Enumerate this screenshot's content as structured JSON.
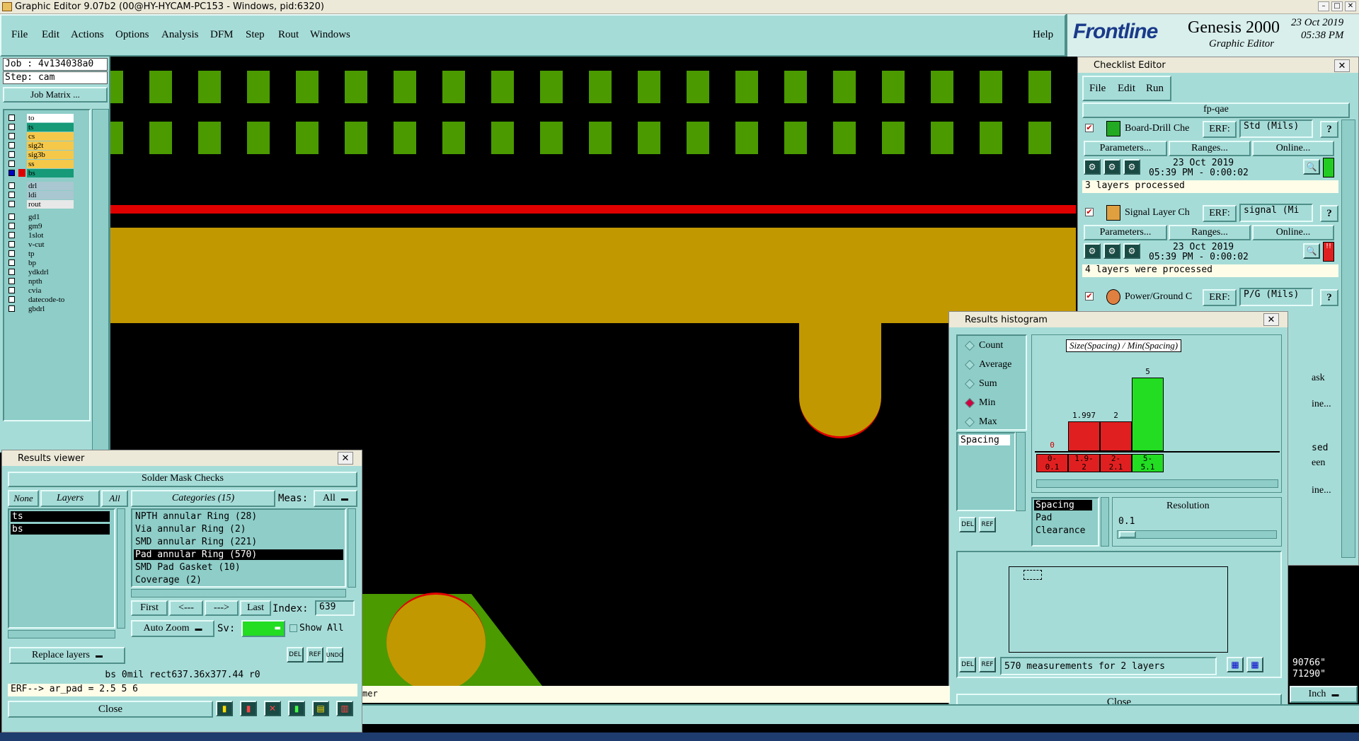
{
  "window_title": "Graphic Editor 9.07b2 (00@HY-HYCAM-PC153 - Windows, pid:6320)",
  "menu": [
    "File",
    "Edit",
    "Actions",
    "Options",
    "Analysis",
    "DFM",
    "Step",
    "Rout",
    "Windows"
  ],
  "help": "Help",
  "brand": {
    "logo": "Frontline",
    "product": "Genesis 2000",
    "subtitle": "Graphic Editor",
    "date": "23 Oct 2019",
    "time": "05:38 PM"
  },
  "job": {
    "job": "Job : 4v134038a0",
    "step": "Step: cam",
    "matrix_button": "Job Matrix ..."
  },
  "layers": [
    {
      "name": "to",
      "color": "#ffffff"
    },
    {
      "name": "ts",
      "color": "#169a78"
    },
    {
      "name": "cs",
      "color": "#f5c84a"
    },
    {
      "name": "sig2t",
      "color": "#f5c84a"
    },
    {
      "name": "sig3b",
      "color": "#f5c84a"
    },
    {
      "name": "ss",
      "color": "#f5c84a"
    },
    {
      "name": "bs",
      "color": "#169a78"
    },
    {
      "name": "drl",
      "color": "#a9c7d0"
    },
    {
      "name": "ldi",
      "color": "#a9c7d0"
    },
    {
      "name": "rout",
      "color": "#e8e8e8"
    },
    {
      "name": "gd1",
      "color": "#8ecdc8"
    },
    {
      "name": "gm9",
      "color": "#8ecdc8"
    },
    {
      "name": "1slot",
      "color": "#8ecdc8"
    },
    {
      "name": "v-cut",
      "color": "#8ecdc8"
    },
    {
      "name": "tp",
      "color": "#8ecdc8"
    },
    {
      "name": "bp",
      "color": "#8ecdc8"
    },
    {
      "name": "ydkdrl",
      "color": "#8ecdc8"
    },
    {
      "name": "npth",
      "color": "#8ecdc8"
    },
    {
      "name": "cvia",
      "color": "#8ecdc8"
    },
    {
      "name": "datecode-to",
      "color": "#8ecdc8"
    },
    {
      "name": "gbdrl",
      "color": "#8ecdc8"
    }
  ],
  "checklist": {
    "title": "Checklist Editor",
    "menu": [
      "File",
      "Edit",
      "Run"
    ],
    "name": "fp-qae",
    "erf_label": "ERF:",
    "params_label": "Parameters...",
    "ranges_label": "Ranges...",
    "online_label": "Online...",
    "checks": [
      {
        "name": "Board-Drill Che",
        "erf": "Std (Mils)",
        "date": "23 Oct 2019",
        "time": "05:39 PM - 0:00:02",
        "status": "3 layers processed",
        "flag": "#22cc22"
      },
      {
        "name": "Signal Layer Ch",
        "erf": "signal (Mi",
        "date": "23 Oct 2019",
        "time": "05:39 PM - 0:00:02",
        "status": "4 layers were processed",
        "flag": "#e02020"
      },
      {
        "name": "Power/Ground C",
        "erf": "P/G (Mils)"
      }
    ],
    "partial_texts": [
      "ask",
      "ine...",
      "sed",
      "een",
      "ine..."
    ]
  },
  "histogram": {
    "title": "Results histogram",
    "modes": [
      "Count",
      "Average",
      "Sum",
      "Min",
      "Max"
    ],
    "selected_mode": "Min",
    "measures": [
      "Spacing"
    ],
    "chart_title": "Size(Spacing) / Min(Spacing)",
    "bins": [
      {
        "label": "0-\n0.1",
        "value": 0,
        "text": "0",
        "color": "#e02020"
      },
      {
        "label": "1.9-\n2",
        "value": 1.997,
        "text": "1.997",
        "color": "#e02020"
      },
      {
        "label": "2-\n2.1",
        "value": 2,
        "text": "2",
        "color": "#e02020"
      },
      {
        "label": "5-\n5.1",
        "value": 5,
        "text": "5",
        "color": "#22dd22"
      }
    ],
    "ymax": 5,
    "attributes": [
      "Spacing",
      "Pad",
      "Clearance"
    ],
    "resolution_label": "Resolution",
    "resolution": "0.1",
    "summary": "570 measurements for 2 layers",
    "close": "Close"
  },
  "results": {
    "title": "Results viewer",
    "header": "Solder Mask Checks",
    "none": "None",
    "layers": "Layers",
    "all": "All",
    "layer_list": [
      "ts",
      "bs"
    ],
    "categories_label": "Categories (15)",
    "meas_label": "Meas:",
    "meas_value": "All",
    "categories": [
      "NPTH annular Ring (28)",
      "Via annular Ring (2)",
      "SMD annular Ring (221)",
      "Pad annular Ring (570)",
      "SMD Pad Gasket (10)",
      "Coverage (2)"
    ],
    "selected_category": "Pad annular Ring (570)",
    "first": "First",
    "prev": "<---",
    "next": "--->",
    "last": "Last",
    "index_label": "Index:",
    "index": "639",
    "auto_zoom": "Auto Zoom",
    "sv_label": "Sv:",
    "show_all": "Show All",
    "replace_layers": "Replace layers",
    "status": "bs 0mil  rect637.36x377.44  r0",
    "erf_line": "ERF--> ar_pad = 2.5 5 6",
    "close": "Close"
  },
  "statusbar": {
    "coord1": "90766\"",
    "coord2": "71290\"",
    "units": "Inch",
    "fragment": "mer"
  }
}
